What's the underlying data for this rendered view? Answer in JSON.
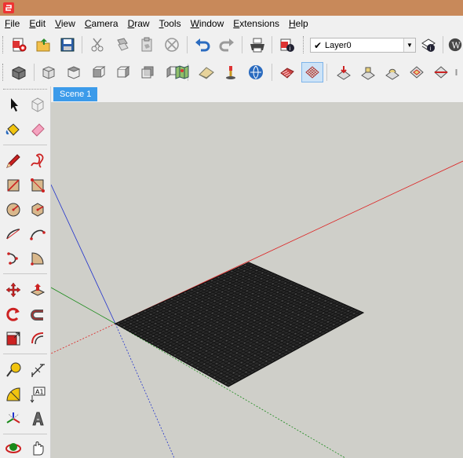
{
  "window": {
    "title": ""
  },
  "menu": [
    {
      "label": "File",
      "u": "F",
      "rest": "ile"
    },
    {
      "label": "Edit",
      "u": "E",
      "rest": "dit"
    },
    {
      "label": "View",
      "u": "V",
      "rest": "iew"
    },
    {
      "label": "Camera",
      "u": "C",
      "rest": "amera"
    },
    {
      "label": "Draw",
      "u": "D",
      "rest": "raw"
    },
    {
      "label": "Tools",
      "u": "T",
      "rest": "ools"
    },
    {
      "label": "Window",
      "u": "W",
      "rest": "indow"
    },
    {
      "label": "Extensions",
      "u": "E",
      "rest": "xtensions"
    },
    {
      "label": "Help",
      "u": "H",
      "rest": "elp"
    }
  ],
  "layer": {
    "current": "Layer0",
    "checked": "✔",
    "dropdown": "▼"
  },
  "scenes": {
    "tab": "Scene 1"
  },
  "toolbar_row1": [
    "new-icon",
    "open-icon",
    "save-icon",
    "cut-icon",
    "copy-icon",
    "paste-icon",
    "erase-icon",
    "undo-icon",
    "redo-icon",
    "print-icon",
    "model-info-icon",
    "layer-visibility-icon",
    "layer-manager-icon"
  ],
  "toolbar_row2": [
    "views-icon",
    "iso-icon",
    "top-icon",
    "front-icon",
    "right-icon",
    "back-icon",
    "left-icon",
    "map-icon",
    "warehouse-icon",
    "extension-warehouse-icon",
    "share-icon",
    "sandbox-from-contours-icon",
    "sandbox-from-scratch-icon",
    "smoove-icon",
    "stamp-icon",
    "drape-icon",
    "add-detail-icon",
    "flip-edge-icon"
  ],
  "left_tools": [
    "select-icon",
    "component-icon",
    "paint-bucket-icon",
    "eraser-icon",
    "pencil-icon",
    "freehand-icon",
    "rectangle-icon",
    "rotated-rectangle-icon",
    "circle-icon",
    "polygon-icon",
    "arc-icon",
    "two-point-arc-icon",
    "three-point-arc-icon",
    "pie-icon",
    "move-icon",
    "push-pull-icon",
    "rotate-icon",
    "follow-me-icon",
    "scale-icon",
    "offset-icon",
    "tape-measure-icon",
    "dimension-icon",
    "protractor-icon",
    "text-icon",
    "axes-icon",
    "3d-text-icon",
    "orbit-icon",
    "pan-icon"
  ],
  "text_tool_label": "A1",
  "colors": {
    "viewport": "#cfcfc9",
    "red_axis": "#d22",
    "green_axis": "#1a8a1a",
    "blue_axis": "#2233cc",
    "scene_tab": "#3c9bea",
    "titlebar": "#c8895a"
  }
}
